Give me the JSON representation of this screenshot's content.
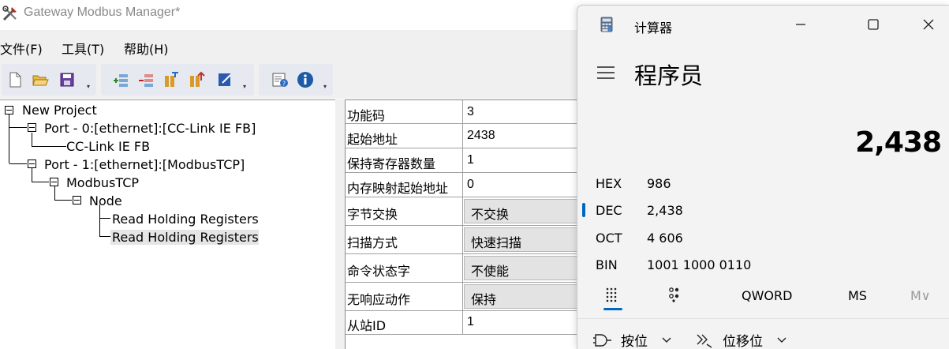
{
  "app": {
    "title": "Gateway Modbus Manager*",
    "menu": [
      {
        "label": "文件(F)"
      },
      {
        "label": "工具(T)"
      },
      {
        "label": "帮助(H)"
      }
    ],
    "toolbar_icons": [
      "new-file-icon",
      "open-folder-icon",
      "save-icon",
      "add-port-icon",
      "remove-port-icon",
      "add-node-icon",
      "add-command-icon",
      "edit-icon",
      "help-icon",
      "info-icon"
    ]
  },
  "tree": {
    "root": "New Project",
    "port0": "Port - 0:[ethernet]:[CC-Link IE FB]",
    "port0_child": "CC-Link IE FB",
    "port1": "Port - 1:[ethernet]:[ModbusTCP]",
    "modbus": "ModbusTCP",
    "node": "Node",
    "cmd1": "Read Holding Registers",
    "cmd2": "Read Holding Registers"
  },
  "properties": [
    {
      "name": "功能码",
      "value": "3"
    },
    {
      "name": "起始地址",
      "value": "2438"
    },
    {
      "name": "保持寄存器数量",
      "value": "1"
    },
    {
      "name": "内存映射起始地址",
      "value": "0"
    },
    {
      "name": "字节交换",
      "value": "不交换"
    },
    {
      "name": "扫描方式",
      "value": "快速扫描"
    },
    {
      "name": "命令状态字",
      "value": "不使能"
    },
    {
      "name": "无响应动作",
      "value": "保持"
    },
    {
      "name": "从站ID",
      "value": "1"
    }
  ],
  "calculator": {
    "title": "计算器",
    "mode": "程序员",
    "display": "2,438",
    "radix": [
      {
        "label": "HEX",
        "value": "986"
      },
      {
        "label": "DEC",
        "value": "2,438"
      },
      {
        "label": "OCT",
        "value": "4 606"
      },
      {
        "label": "BIN",
        "value": "1001 1000 0110"
      }
    ],
    "selected_radix": "DEC",
    "tabs": {
      "word_size": "QWORD",
      "memory": "MS",
      "memory_list": "M∨"
    },
    "ops": {
      "bitwise": "按位",
      "bitshift": "位移位"
    },
    "accent": "#0067c0"
  }
}
